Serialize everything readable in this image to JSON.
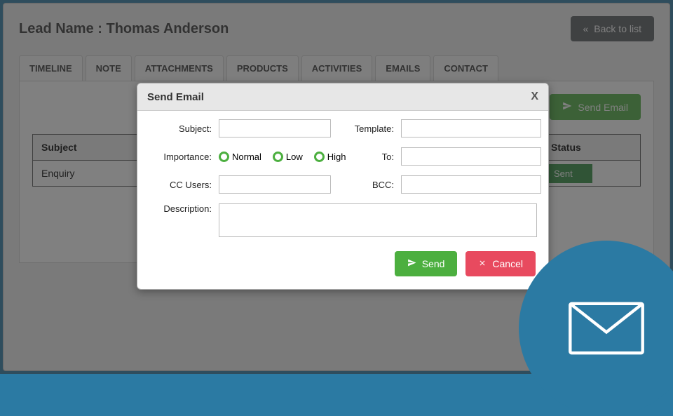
{
  "header": {
    "lead_label": "Lead Name : Thomas Anderson",
    "back_button": "Back to list"
  },
  "tabs": [
    "TIMELINE",
    "NOTE",
    "ATTACHMENTS",
    "PRODUCTS",
    "ACTIVITIES",
    "EMAILS",
    "CONTACT"
  ],
  "content": {
    "send_email_button": "Send Email",
    "table": {
      "columns": [
        "Subject",
        "Status"
      ],
      "rows": [
        {
          "subject": "Enquiry",
          "status": "Sent"
        }
      ]
    }
  },
  "modal": {
    "title": "Send Email",
    "close": "X",
    "fields": {
      "subject_label": "Subject:",
      "subject_value": "",
      "template_label": "Template:",
      "template_value": "",
      "importance_label": "Importance:",
      "importance_options": {
        "normal": "Normal",
        "low": "Low",
        "high": "High"
      },
      "to_label": "To:",
      "to_value": "",
      "cc_label": "CC Users:",
      "cc_value": "",
      "bcc_label": "BCC:",
      "bcc_value": "",
      "description_label": "Description:",
      "description_value": ""
    },
    "buttons": {
      "send": "Send",
      "cancel": "Cancel"
    }
  },
  "colors": {
    "frame_blue": "#2b7aa3",
    "green": "#4caf3f",
    "red": "#e84a5f",
    "gray_btn": "#555a5e"
  }
}
